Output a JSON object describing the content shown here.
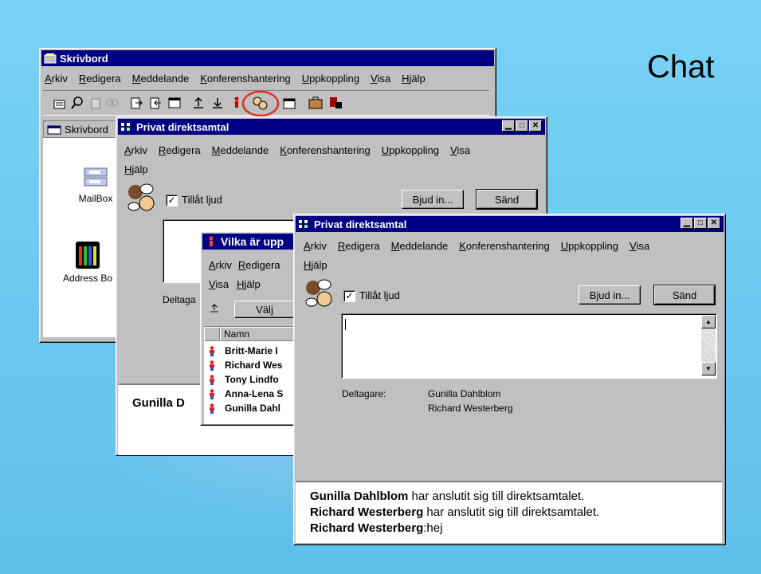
{
  "slide": {
    "title": "Chat"
  },
  "desktop_window": {
    "title": "Skrivbord",
    "menu": [
      "Arkiv",
      "Redigera",
      "Meddelande",
      "Konferenshantering",
      "Uppkoppling",
      "Visa",
      "Hjälp"
    ],
    "address_label": "Skrivbord",
    "icons": [
      {
        "label": "MailBox",
        "icon": "mailbox-icon"
      },
      {
        "label": "Address Bo",
        "icon": "address-book-icon"
      }
    ]
  },
  "chat_window_back": {
    "title": "Privat direktsamtal",
    "menu": [
      "Arkiv",
      "Redigera",
      "Meddelande",
      "Konferenshantering",
      "Uppkoppling",
      "Visa"
    ],
    "menu_row2": [
      "Hjälp"
    ],
    "sound_label": "Tillåt ljud",
    "invite_button": "Bjud in...",
    "send_button": "Sänd",
    "participants_label": "Deltaga",
    "transcript_partial": "Gunilla D"
  },
  "who_window": {
    "title": "Vilka är upp",
    "menu": [
      "Arkiv",
      "Redigera"
    ],
    "menu_row2": [
      "Visa",
      "Hjälp"
    ],
    "select_button": "Välj",
    "column_header": "Namn",
    "names": [
      "Britt-Marie I",
      "Richard Wes",
      "Tony Lindfo",
      "Anna-Lena S",
      "Gunilla Dahl"
    ]
  },
  "chat_window_front": {
    "title": "Privat direktsamtal",
    "menu": [
      "Arkiv",
      "Redigera",
      "Meddelande",
      "Konferenshantering",
      "Uppkoppling",
      "Visa"
    ],
    "menu_row2": [
      "Hjälp"
    ],
    "sound_label": "Tillåt ljud",
    "sound_checked": true,
    "invite_button": "Bjud in...",
    "send_button": "Sänd",
    "message_input": "",
    "participants_label": "Deltagare:",
    "participants": [
      "Gunilla Dahlblom",
      "Richard Westerberg"
    ],
    "transcript": [
      {
        "name": "Gunilla Dahlblom",
        "text": " har anslutit sig till direktsamtalet."
      },
      {
        "name": "Richard Westerberg",
        "text": " har anslutit sig till direktsamtalet."
      },
      {
        "name": "Richard Westerberg",
        "text": ":hej"
      }
    ]
  },
  "colors": {
    "titlebar": "#000082",
    "face": "#c0c0c0",
    "background": "#79d3f6",
    "highlight_circle": "#e0302a"
  }
}
